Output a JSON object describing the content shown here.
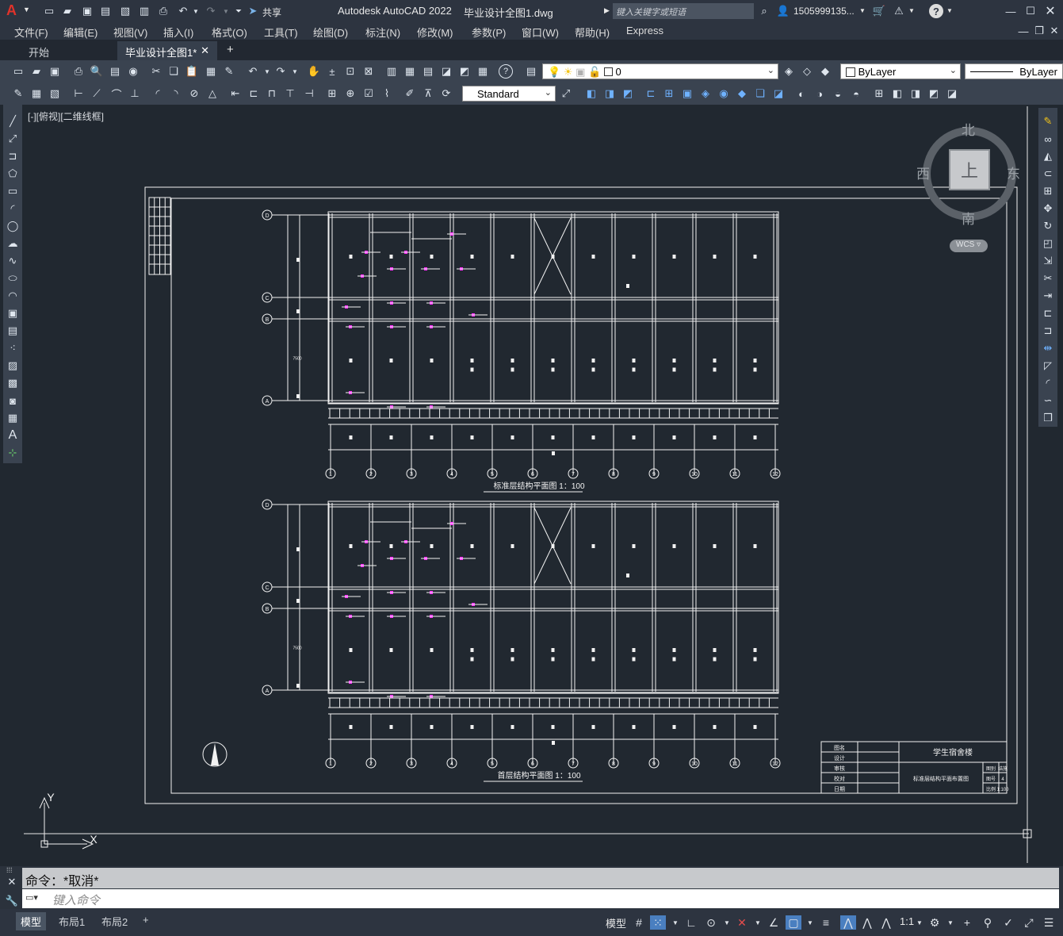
{
  "titlebar": {
    "app_logo": "A",
    "share_label": "共享",
    "app_title": "Autodesk AutoCAD 2022",
    "doc_title": "毕业设计全图1.dwg",
    "search_placeholder": "键入关键字或短语",
    "user": "1505999135...",
    "icons": [
      "new-icon",
      "open-icon",
      "save-icon",
      "saveas-icon",
      "publish-icon",
      "print-icon",
      "undo-icon",
      "redo-icon",
      "search-icon",
      "user-icon",
      "cart-icon",
      "autodesk-icon",
      "help-icon"
    ]
  },
  "menus": [
    "文件(F)",
    "编辑(E)",
    "视图(V)",
    "插入(I)",
    "格式(O)",
    "工具(T)",
    "绘图(D)",
    "标注(N)",
    "修改(M)",
    "参数(P)",
    "窗口(W)",
    "帮助(H)",
    "Express"
  ],
  "tabs": {
    "start": "开始",
    "current": "毕业设计全图1*",
    "close": "✕",
    "add": "+"
  },
  "toolbar": {
    "layer_value": "0",
    "color_value": "ByLayer",
    "linetype_value": "ByLayer",
    "textstyle_value": "Standard"
  },
  "viewport": {
    "label": "[-][俯视][二维线框]"
  },
  "viewcube": {
    "north": "北",
    "south": "南",
    "east": "东",
    "west": "西",
    "top": "上",
    "wcs": "WCS"
  },
  "ucs": {
    "x": "X",
    "y": "Y"
  },
  "drawing": {
    "plan1_title": "标准层结构平面图  1：100",
    "plan2_title": "首层结构平面图  1：100",
    "axis_numbers": [
      "1",
      "2",
      "3",
      "4",
      "5",
      "6",
      "7",
      "8",
      "9",
      "10",
      "11",
      "12"
    ],
    "axis_letters": [
      "D",
      "C",
      "B",
      "A"
    ],
    "dim_text": "7500",
    "title_block": {
      "project": "学生宿舍楼",
      "drawing_name": "标准层结构平面布置图",
      "rows_left": [
        "图名",
        "设计",
        "审核",
        "校对",
        "日期"
      ],
      "rows_right": [
        [
          "图别",
          "结施"
        ],
        [
          "图号",
          "4"
        ],
        [
          "比例",
          "1:100"
        ]
      ]
    }
  },
  "command": {
    "history": "命令：*取消*",
    "placeholder": "键入命令"
  },
  "layouts": [
    "模型",
    "布局1",
    "布局2",
    "+"
  ],
  "status": {
    "model_label": "模型",
    "scale": "1:1"
  }
}
